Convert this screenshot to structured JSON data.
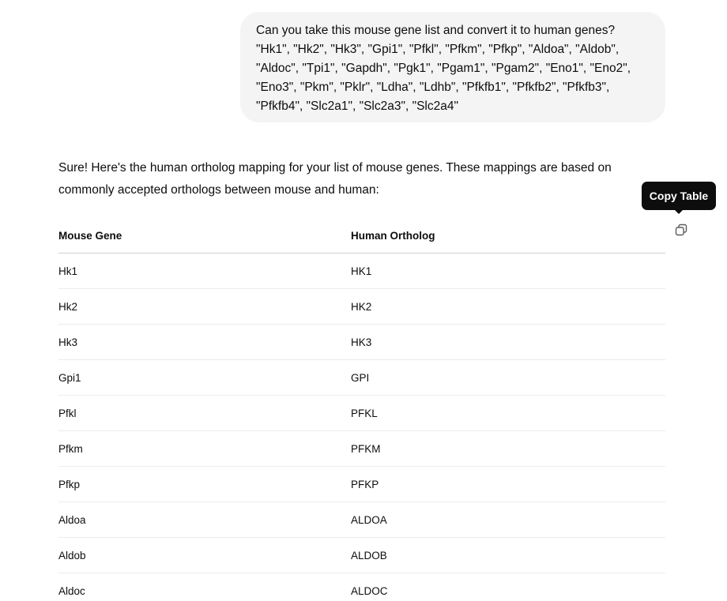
{
  "user_message": {
    "lines": [
      "Can you take this mouse gene list and convert it to human genes?",
      "\"Hk1\", \"Hk2\", \"Hk3\", \"Gpi1\", \"Pfkl\", \"Pfkm\", \"Pfkp\", \"Aldoa\", \"Aldob\",",
      "\"Aldoc\", \"Tpi1\", \"Gapdh\", \"Pgk1\", \"Pgam1\", \"Pgam2\", \"Eno1\", \"Eno2\",",
      "\"Eno3\", \"Pkm\", \"Pklr\", \"Ldha\", \"Ldhb\", \"Pfkfb1\", \"Pfkfb2\", \"Pfkfb3\",",
      "\"Pfkfb4\", \"Slc2a1\", \"Slc2a3\", \"Slc2a4\""
    ]
  },
  "assistant_message": {
    "intro_lines": [
      "Sure! Here's the human ortholog mapping for your list of mouse genes. These mappings are based on",
      "commonly accepted orthologs between mouse and human:"
    ]
  },
  "tooltip": {
    "text": "Copy Table"
  },
  "copy_button": {
    "icon": "copy-icon"
  },
  "table": {
    "headers": [
      "Mouse Gene",
      "Human Ortholog"
    ],
    "rows": [
      [
        "Hk1",
        "HK1"
      ],
      [
        "Hk2",
        "HK2"
      ],
      [
        "Hk3",
        "HK3"
      ],
      [
        "Gpi1",
        "GPI"
      ],
      [
        "Pfkl",
        "PFKL"
      ],
      [
        "Pfkm",
        "PFKM"
      ],
      [
        "Pfkp",
        "PFKP"
      ],
      [
        "Aldoa",
        "ALDOA"
      ],
      [
        "Aldob",
        "ALDOB"
      ],
      [
        "Aldoc",
        "ALDOC"
      ]
    ]
  },
  "colors": {
    "user_bubble_bg": "#f4f4f4",
    "tooltip_bg": "#0d0d0d",
    "text": "#0d0d0d"
  }
}
